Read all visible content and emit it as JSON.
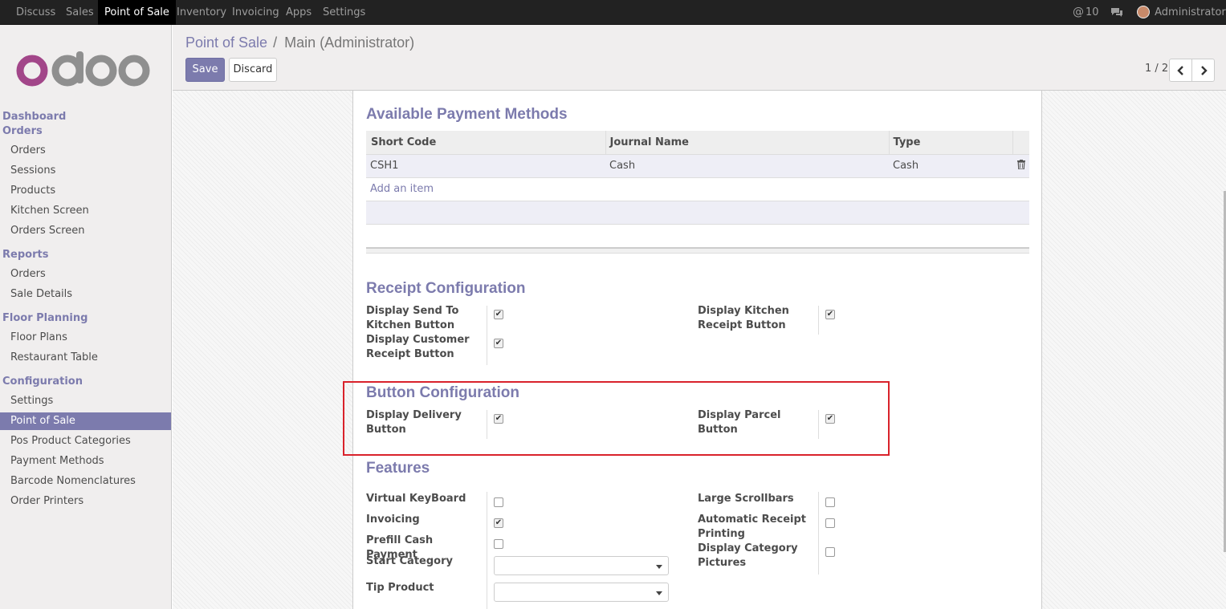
{
  "topbar": {
    "menu": [
      "Discuss",
      "Sales",
      "Point of Sale",
      "Inventory",
      "Invoicing",
      "Apps",
      "Settings"
    ],
    "mentions": "10",
    "user": "Administrator"
  },
  "sidebar": {
    "logo": "odoo",
    "sections": [
      {
        "title": "Dashboard",
        "items": []
      },
      {
        "title": "Orders",
        "items": [
          "Orders",
          "Sessions",
          "Products",
          "Kitchen Screen",
          "Orders Screen"
        ]
      },
      {
        "title": "Reports",
        "items": [
          "Orders",
          "Sale Details"
        ]
      },
      {
        "title": "Floor Planning",
        "items": [
          "Floor Plans",
          "Restaurant Table"
        ]
      },
      {
        "title": "Configuration",
        "items": [
          "Settings",
          "Point of Sale",
          "Pos Product Categories",
          "Payment Methods",
          "Barcode Nomenclatures",
          "Order Printers"
        ]
      }
    ]
  },
  "breadcrumb": {
    "parent": "Point of Sale",
    "sep": "/",
    "current": "Main (Administrator)"
  },
  "buttons": {
    "save": "Save",
    "discard": "Discard"
  },
  "pager": {
    "text": "1 / 2"
  },
  "payment": {
    "title": "Available Payment Methods",
    "columns": [
      "Short Code",
      "Journal Name",
      "Type"
    ],
    "rows": [
      {
        "short_code": "CSH1",
        "journal": "Cash",
        "type": "Cash"
      }
    ],
    "add_item": "Add an item"
  },
  "receipt": {
    "title": "Receipt Configuration",
    "send_kitchen": "Display Send To Kitchen Button",
    "customer_receipt": "Display Customer Receipt Button",
    "kitchen_receipt": "Display Kitchen Receipt Button"
  },
  "button_config": {
    "title": "Button Configuration",
    "delivery": "Display Delivery Button",
    "parcel": "Display Parcel Button"
  },
  "features": {
    "title": "Features",
    "virtual_keyboard": "Virtual KeyBoard",
    "invoicing": "Invoicing",
    "prefill_cash": "Prefill Cash Payment",
    "start_category": "Start Category",
    "tip_product": "Tip Product",
    "large_scrollbars": "Large Scrollbars",
    "auto_receipt": "Automatic Receipt Printing",
    "category_pictures": "Display Category Pictures"
  },
  "colors": {
    "accent": "#7c7bad",
    "highlight": "#d9222b"
  }
}
